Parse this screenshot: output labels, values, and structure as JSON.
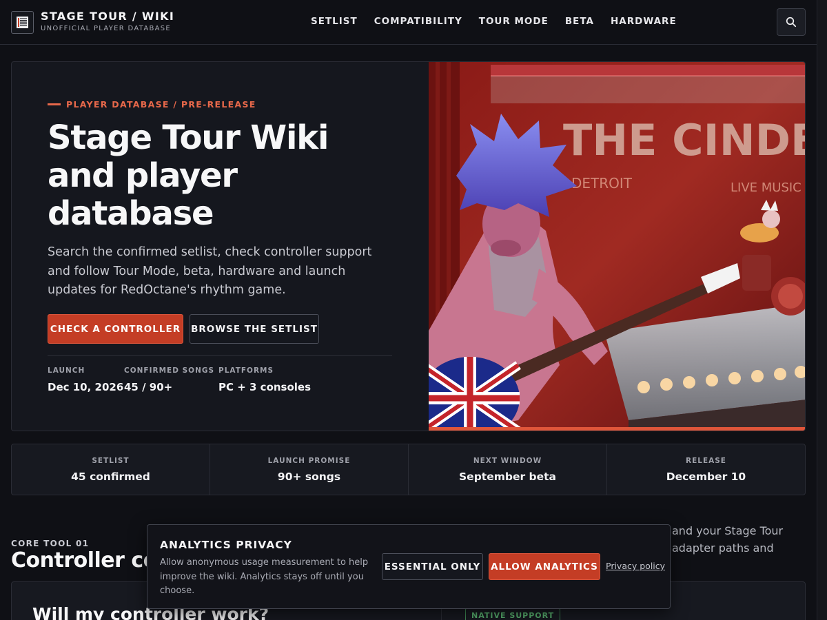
{
  "header": {
    "brand_title": "STAGE TOUR / WIKI",
    "brand_subtitle": "UNOFFICIAL PLAYER DATABASE",
    "nav": [
      "SETLIST",
      "COMPATIBILITY",
      "TOUR MODE",
      "BETA",
      "HARDWARE"
    ]
  },
  "hero": {
    "eyebrow": "PLAYER DATABASE / PRE-RELEASE",
    "title_lines": [
      "Stage Tour Wiki",
      "and player",
      "database"
    ],
    "description": "Search the confirmed setlist, check controller support and follow Tour Mode, beta, hardware and launch updates for RedOctane's rhythm game.",
    "primary_button": "CHECK A CONTROLLER",
    "secondary_button": "BROWSE THE SETLIST",
    "stats": [
      {
        "label": "LAUNCH",
        "value": "Dec 10, 2026"
      },
      {
        "label": "CONFIRMED SONGS",
        "value": "45 / 90+"
      },
      {
        "label": "PLATFORMS",
        "value": "PC + 3 consoles"
      }
    ],
    "image_sign_text": "THE CINDER TAP",
    "image_sign_city": "DETROIT",
    "image_sign_live": "LIVE MUSIC"
  },
  "strip": [
    {
      "label": "SETLIST",
      "value": "45 confirmed"
    },
    {
      "label": "LAUNCH PROMISE",
      "value": "90+ songs"
    },
    {
      "label": "NEXT WINDOW",
      "value": "September beta"
    },
    {
      "label": "RELEASE",
      "value": "December 10"
    }
  ],
  "section": {
    "eyebrow": "CORE TOOL 01",
    "title": "Controller compatibility",
    "description_lines": [
      "and your Stage Tour",
      "adapter paths and"
    ],
    "card_title": "Will my controller work?",
    "badge": "NATIVE SUPPORT"
  },
  "consent": {
    "title": "ANALYTICS PRIVACY",
    "text": "Allow anonymous usage measurement to help improve the wiki. Analytics stays off until you choose.",
    "essential_button": "ESSENTIAL ONLY",
    "allow_button": "ALLOW ANALYTICS",
    "privacy_link": "Privacy policy"
  },
  "colors": {
    "accent": "#c43d25",
    "accent_text": "#e7684a",
    "background": "#0f1015",
    "badge_green": "#58b06f"
  },
  "icons": {
    "logo": "setlist-logo-icon",
    "search": "search-icon"
  }
}
